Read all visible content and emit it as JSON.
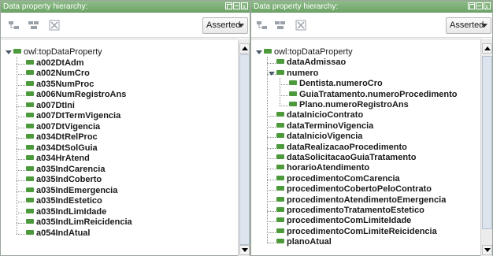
{
  "left_panel": {
    "title": "Data property hierarchy:",
    "select_value": "Asserted",
    "root_label": "owl:topDataProperty",
    "items": [
      "a002DtAdm",
      "a002NumCro",
      "a035NumProc",
      "a006NumRegistroAns",
      "a007DtIni",
      "a007DtTermVigencia",
      "a007DtVigencia",
      "a034DtRelProc",
      "a034DtSolGuia",
      "a034HrAtend",
      "a035IndCarencia",
      "a035IndCoberto",
      "a035IndEmergencia",
      "a035IndEstetico",
      "a035IndLimIdade",
      "a035IndLimReicidencia",
      "a054IndAtual"
    ]
  },
  "right_panel": {
    "title": "Data property hierarchy:",
    "select_value": "Asserted",
    "root_label": "owl:topDataProperty",
    "items": [
      {
        "label": "dataAdmissao",
        "level": 1
      },
      {
        "label": "numero",
        "level": 1,
        "expanded": true
      },
      {
        "label": "Dentista.numeroCro",
        "level": 2
      },
      {
        "label": "GuiaTratamento.numeroProcedimento",
        "level": 2
      },
      {
        "label": "Plano.numeroRegistroAns",
        "level": 2
      },
      {
        "label": "dataInicioContrato",
        "level": 1
      },
      {
        "label": "dataTerminoVigencia",
        "level": 1
      },
      {
        "label": "dataInicioVigencia",
        "level": 1
      },
      {
        "label": "dataRealizacaoProcedimento",
        "level": 1
      },
      {
        "label": "dataSolicitacaoGuiaTratamento",
        "level": 1
      },
      {
        "label": "horarioAtendimento",
        "level": 1
      },
      {
        "label": "procedimentoComCarencia",
        "level": 1
      },
      {
        "label": "procedimentoCobertoPeloContrato",
        "level": 1
      },
      {
        "label": "procedimentoAtendimentoEmergencia",
        "level": 1
      },
      {
        "label": "procedimentoTratamentoEstetico",
        "level": 1
      },
      {
        "label": "procedimentoComLimiteIdade",
        "level": 1
      },
      {
        "label": "procedimentoComLimiteReicidencia",
        "level": 1
      },
      {
        "label": "planoAtual",
        "level": 1
      }
    ]
  },
  "colors": {
    "titlebar": "#7aaf73",
    "property_icon": "#4c9a3c"
  },
  "icons": [
    "add-subproperty-icon",
    "add-sibling-icon",
    "delete-property-icon",
    "expand-icon",
    "dropdown-arrow-icon"
  ]
}
